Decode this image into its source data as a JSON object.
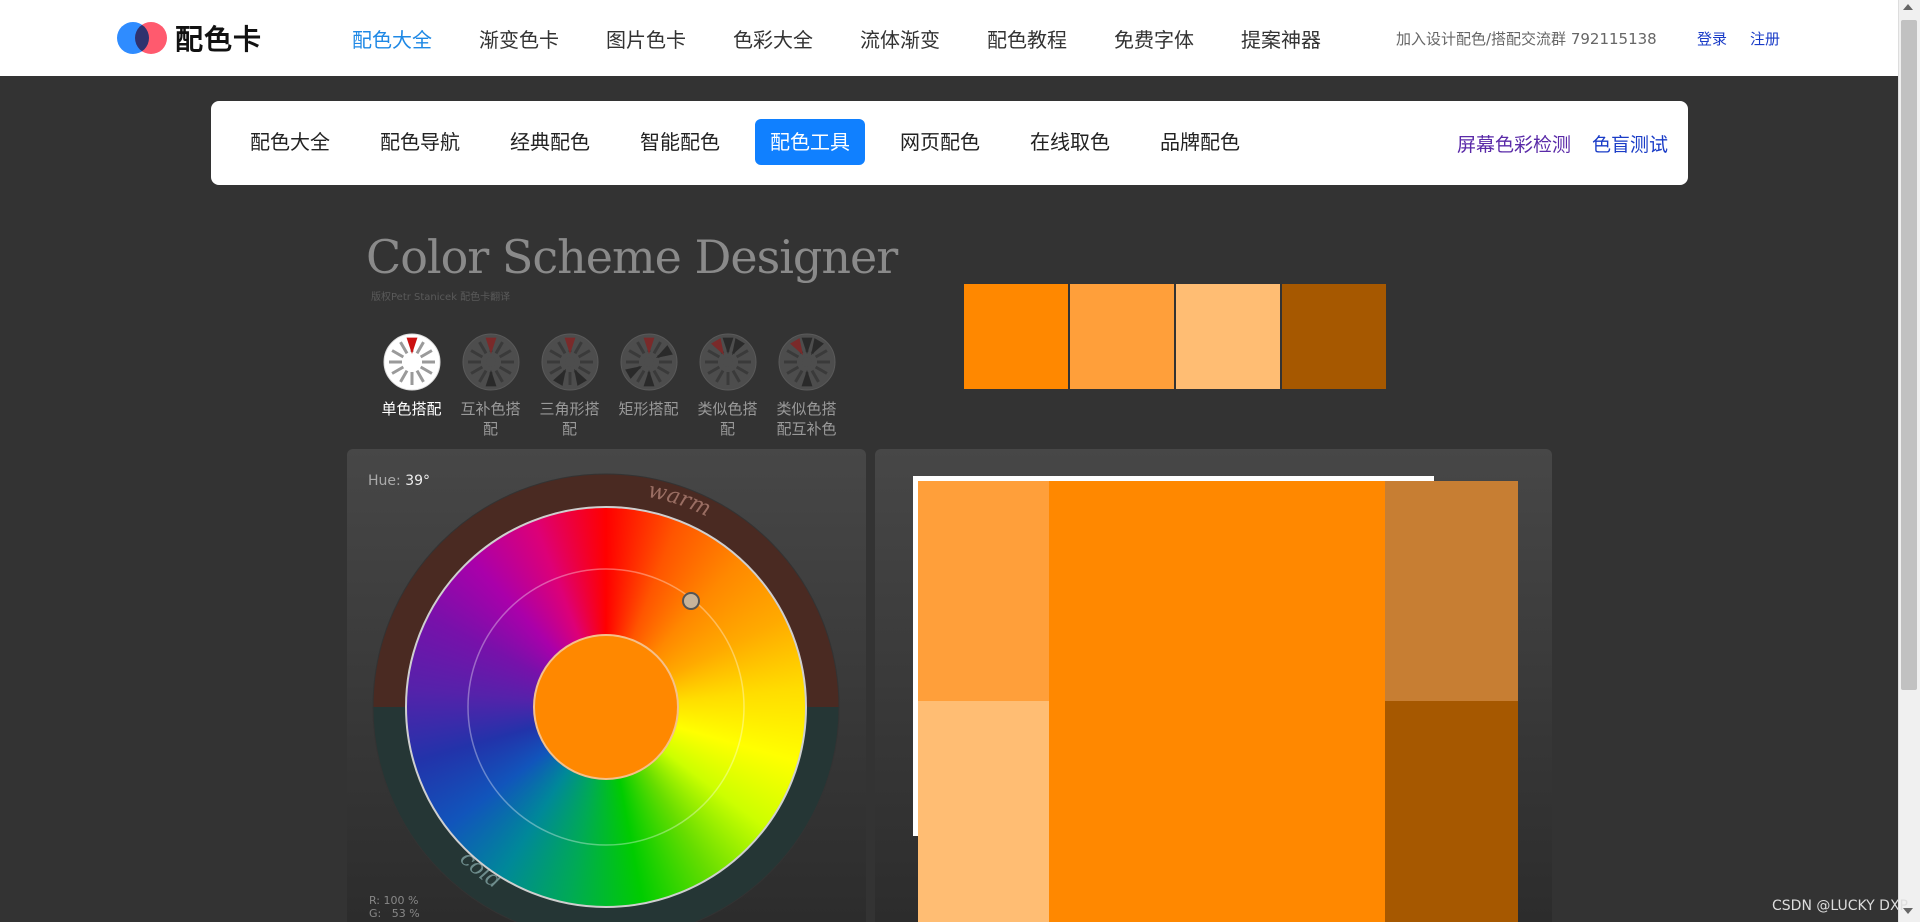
{
  "site": {
    "logo_text": "配色卡",
    "nav": [
      "配色大全",
      "渐变色卡",
      "图片色卡",
      "色彩大全",
      "流体渐变",
      "配色教程",
      "免费字体",
      "提案神器"
    ],
    "nav_active": 0,
    "qq_group": "加入设计配色/搭配交流群 792115138",
    "login": "登录",
    "register": "注册"
  },
  "subnav": {
    "items": [
      "配色大全",
      "配色导航",
      "经典配色",
      "智能配色",
      "配色工具",
      "网页配色",
      "在线取色",
      "品牌配色"
    ],
    "active": 4,
    "screen_check": "屏幕色彩检测",
    "blind_test": "色盲测试"
  },
  "designer": {
    "title": "Color Scheme Designer",
    "subtitle": "版权Petr Stanicek 配色卡翻译",
    "modes": [
      "单色搭配",
      "互补色搭配",
      "三角形搭配",
      "矩形搭配",
      "类似色搭配",
      "类似色搭配互补色"
    ],
    "mode_active": 0,
    "hue_label": "Hue:",
    "hue_value": "39°",
    "wheel_warm": "warm",
    "wheel_cold": "cold",
    "rgb_readout": "R: 100 %\nG:   53 %"
  },
  "colors": {
    "primary": "#ff8800",
    "light": "#ff9f3a",
    "lighter": "#ffbd73",
    "dark": "#a65800",
    "muted": "#c77e33"
  },
  "watermark": "CSDN @LUCKY DXP"
}
